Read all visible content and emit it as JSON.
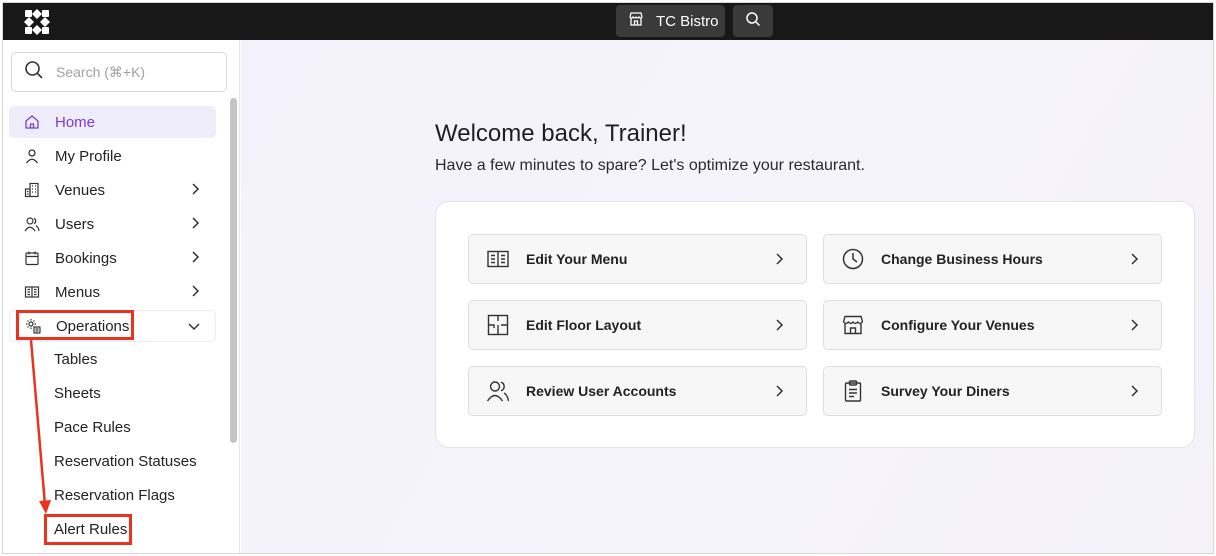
{
  "topbar": {
    "logo_icon": "app-logo-icon",
    "venue_label": "TC Bistro",
    "venue_icon": "storefront-icon",
    "search_icon": "search-icon"
  },
  "sidebar": {
    "search_placeholder": "Search (⌘+K)",
    "items": [
      {
        "label": "Home",
        "icon": "home-icon",
        "active": true
      },
      {
        "label": "My Profile",
        "icon": "user-icon"
      },
      {
        "label": "Venues",
        "icon": "building-icon",
        "chevron": "right"
      },
      {
        "label": "Users",
        "icon": "users-icon",
        "chevron": "right"
      },
      {
        "label": "Bookings",
        "icon": "calendar-icon",
        "chevron": "right"
      },
      {
        "label": "Menus",
        "icon": "menu-book-icon",
        "chevron": "right"
      },
      {
        "label": "Operations",
        "icon": "operations-gear-icon",
        "chevron": "down",
        "expanded": true
      }
    ],
    "operations_sub": [
      "Tables",
      "Sheets",
      "Pace Rules",
      "Reservation Statuses",
      "Reservation Flags",
      "Alert Rules"
    ]
  },
  "main": {
    "welcome": "Welcome back, Trainer!",
    "subtitle": "Have a few minutes to spare? Let's optimize your restaurant.",
    "actions": [
      {
        "label": "Edit Your Menu",
        "icon": "menu-book-icon"
      },
      {
        "label": "Change Business Hours",
        "icon": "clock-icon"
      },
      {
        "label": "Edit Floor Layout",
        "icon": "floor-layout-icon"
      },
      {
        "label": "Configure Your Venues",
        "icon": "storefront-icon"
      },
      {
        "label": "Review User Accounts",
        "icon": "users-icon"
      },
      {
        "label": "Survey Your Diners",
        "icon": "clipboard-icon"
      }
    ]
  },
  "colors": {
    "accent": "#7c3bd6",
    "active_bg": "#f0edfb",
    "annotation": "#e8341c",
    "topbar": "#181818"
  }
}
